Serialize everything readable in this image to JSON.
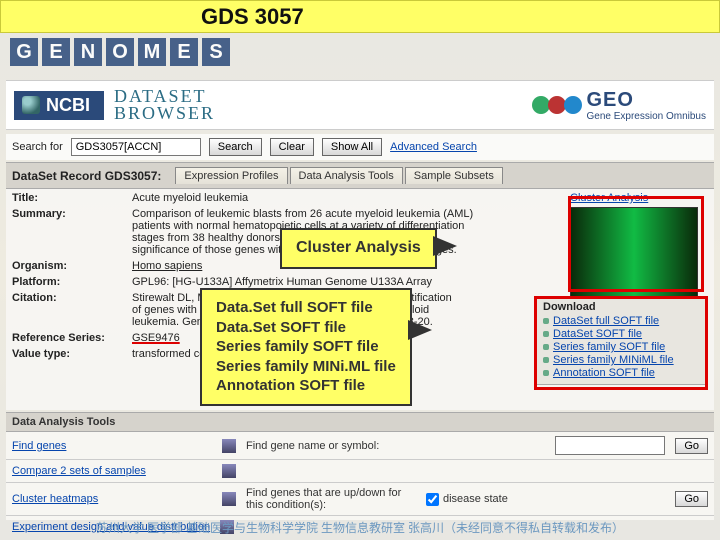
{
  "slide": {
    "title": "GDS 3057"
  },
  "header": {
    "ncbi": "NCBI",
    "ds_browser_l1": "DATASET",
    "ds_browser_l2": "BROWSER",
    "geo_l1": "GEO",
    "geo_l2": "Gene Expression Omnibus"
  },
  "search": {
    "label": "Search for",
    "value": "GDS3057[ACCN]",
    "btn_search": "Search",
    "btn_clear": "Clear",
    "btn_showall": "Show All",
    "advanced": "Advanced Search"
  },
  "record_bar": {
    "title": "DataSet Record GDS3057:",
    "tabs": [
      "Expression Profiles",
      "Data Analysis Tools",
      "Sample Subsets"
    ]
  },
  "meta": {
    "title_lab": "Title:",
    "title_val": "Acute myeloid leukemia",
    "summary_lab": "Summary:",
    "summary_val": "Comparison of leukemic blasts from 26 acute myeloid leukemia (AML) patients with normal hematopoietic cells at a variety of differentiation stages from 38 healthy donors. Results provide insight into the significance of those genes with AML-specific expression changes.",
    "organism_lab": "Organism:",
    "organism_val": "Homo sapiens",
    "platform_lab": "Platform:",
    "platform_val": "GPL96: [HG-U133A] Affymetrix Human Genome U133A Array",
    "citation_lab": "Citation:",
    "citation_val": "Stirewalt DL, Meshinchi S, Kopecky KJ, Fan W et al. Identification of genes with abnormal expression changes in acute myeloid leukemia. Genes Chromosomes Cancer 2008 Jan;47(1):8-20.",
    "refseries_lab": "Reference Series:",
    "refseries_val": "GSE9476",
    "valuetype_lab": "Value type:",
    "valuetype_val": "transformed count"
  },
  "side": {
    "cluster_link": "Cluster Analysis"
  },
  "downloads": {
    "header": "Download",
    "items": [
      "DataSet full SOFT file",
      "DataSet SOFT file",
      "Series family SOFT file",
      "Series family MINiML file",
      "Annotation SOFT file"
    ]
  },
  "callouts": {
    "cluster": "Cluster Analysis",
    "dl_l1": "Data.Set full SOFT file",
    "dl_l2": "Data.Set SOFT file",
    "dl_l3": "Series family SOFT file",
    "dl_l4": "Series family MINi.ML file",
    "dl_l5": "Annotation SOFT file"
  },
  "tools": {
    "header": "Data Analysis Tools",
    "row1_lab": "Find genes",
    "row1_hint": "Find gene name or symbol:",
    "row1_go": "Go",
    "row2_lab": "Compare 2 sets of samples",
    "row3_lab": "Cluster heatmaps",
    "row3_hint": "Find genes that are up/down for this condition(s):",
    "row3_go": "Go",
    "row3_opt1": "disease state",
    "row4_lab": "Experiment design and value distribution"
  },
  "footer": "苏州大学 医学部 基础医学与生物科学学院 生物信息教研室 张高川（未经同意不得私自转载和发布）"
}
